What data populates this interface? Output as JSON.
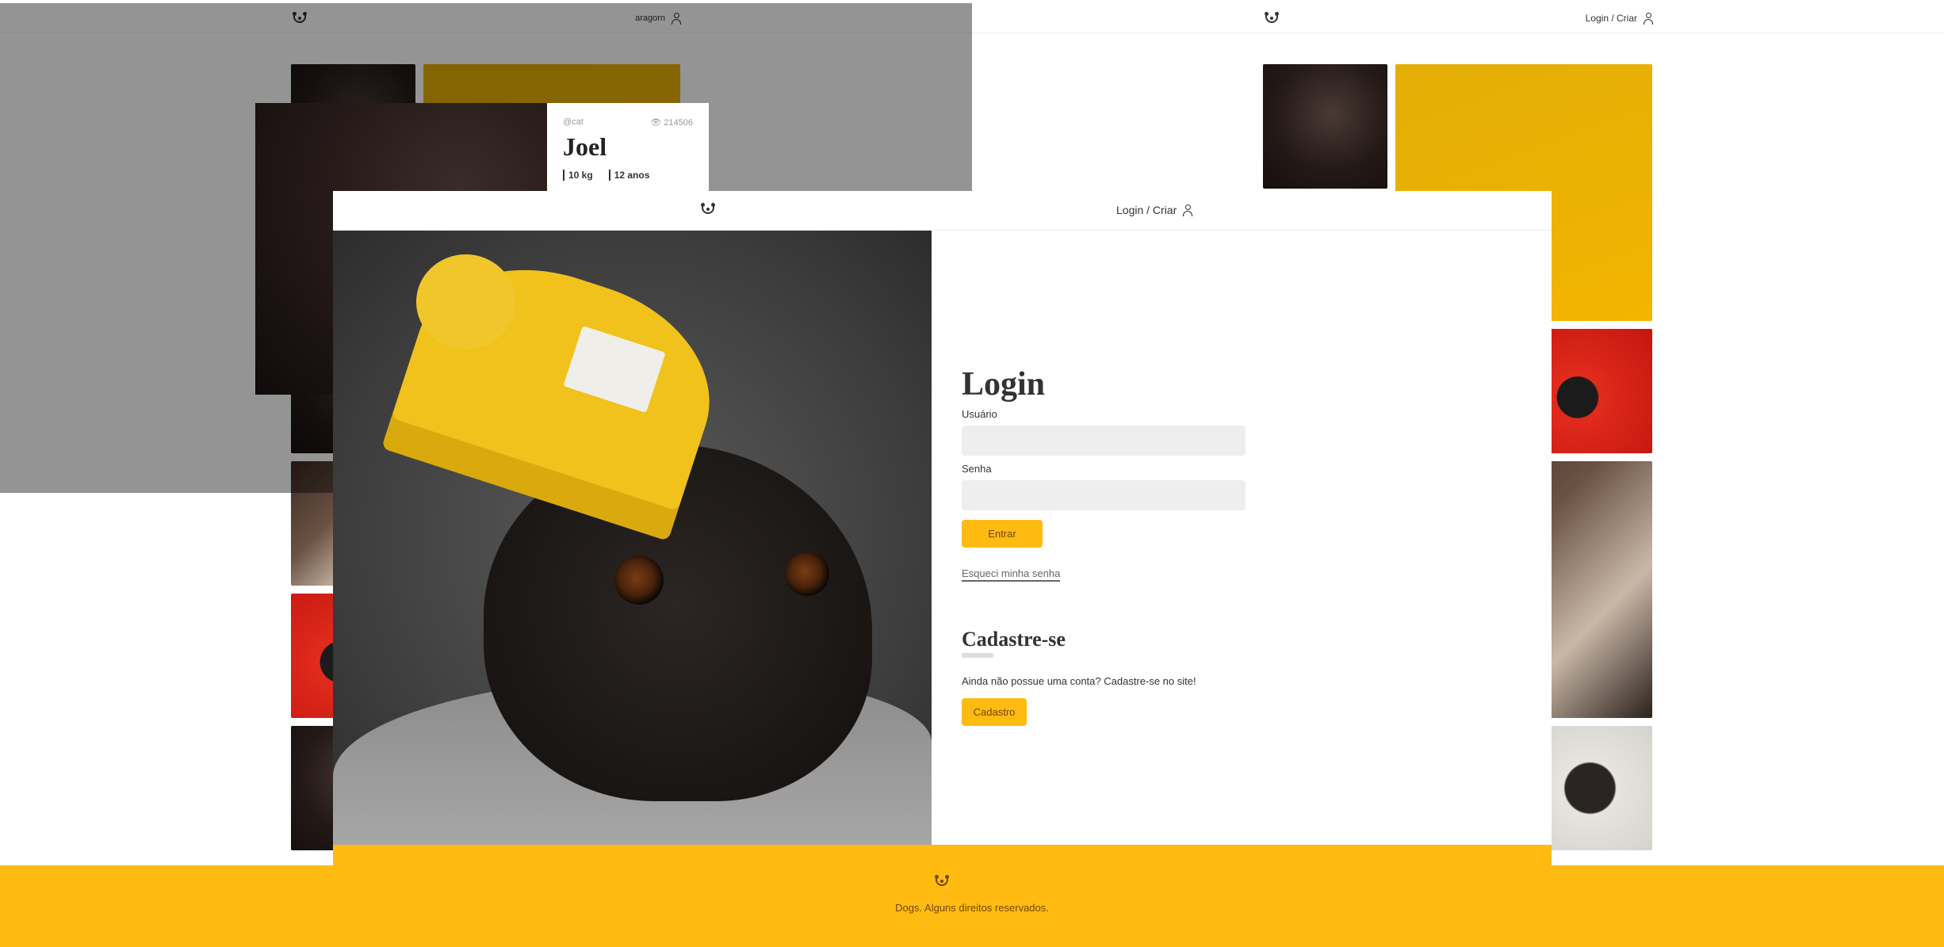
{
  "back_header_left": {
    "user_label": "aragorn"
  },
  "back_header_right": {
    "login_label": "Login / Criar"
  },
  "modal": {
    "author": "@cat",
    "views": "214506",
    "name": "Joel",
    "weight": "10 kg",
    "age": "12 anos"
  },
  "header": {
    "login_label": "Login / Criar"
  },
  "login": {
    "title": "Login",
    "username_label": "Usuário",
    "username_value": "",
    "password_label": "Senha",
    "password_value": "",
    "submit_label": "Entrar",
    "forgot_label": "Esqueci minha senha"
  },
  "signup": {
    "title": "Cadastre-se",
    "text": "Ainda não possue uma conta? Cadastre-se no site!",
    "button_label": "Cadastro"
  },
  "footer": {
    "text": "Dogs. Alguns direitos reservados."
  },
  "colors": {
    "accent": "#ffbb11",
    "accent_text": "#764701"
  }
}
